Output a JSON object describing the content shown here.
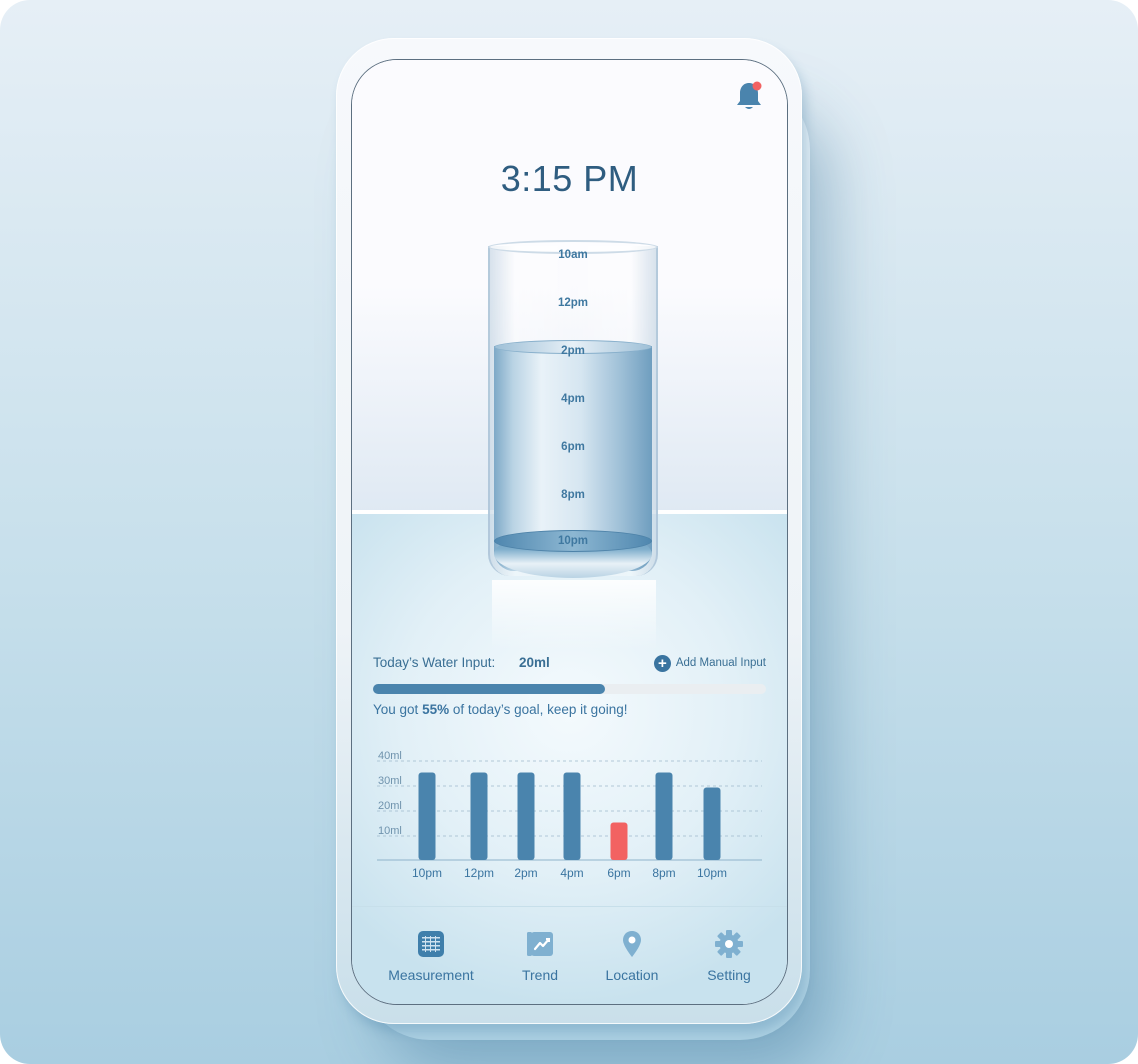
{
  "status": {
    "time": "3:15 PM",
    "notification_badge": true
  },
  "glass": {
    "markings": [
      "10am",
      "12pm",
      "2pm",
      "4pm",
      "6pm",
      "8pm",
      "10pm"
    ],
    "fill_level_label": "2pm"
  },
  "water_input": {
    "label": "Today’s Water Input:",
    "value": "20ml",
    "add_button": "Add Manual Input",
    "progress_fraction": 0.59,
    "goal_prefix": "You got ",
    "goal_percent": "55%",
    "goal_suffix": " of today’s goal, keep it going!"
  },
  "chart_data": {
    "type": "bar",
    "categories": [
      "10pm",
      "12pm",
      "2pm",
      "4pm",
      "6pm",
      "8pm",
      "10pm"
    ],
    "values": [
      35,
      35,
      35,
      35,
      15,
      35,
      29
    ],
    "y_ticks": [
      "10ml",
      "20ml",
      "30ml",
      "40ml"
    ],
    "ylim": [
      0,
      40
    ],
    "grid": true,
    "bar_color": "#4a84ad",
    "highlight_color": "#f26262",
    "highlight_index": 4
  },
  "nav": {
    "items": [
      {
        "label": "Measurement",
        "icon": "measurement-icon"
      },
      {
        "label": "Trend",
        "icon": "trend-icon"
      },
      {
        "label": "Location",
        "icon": "location-pin-icon"
      },
      {
        "label": "Setting",
        "icon": "gear-icon"
      }
    ]
  },
  "colors": {
    "primary": "#3a74a0",
    "accent_red": "#f26262",
    "progress_track": "#eaeef1"
  }
}
